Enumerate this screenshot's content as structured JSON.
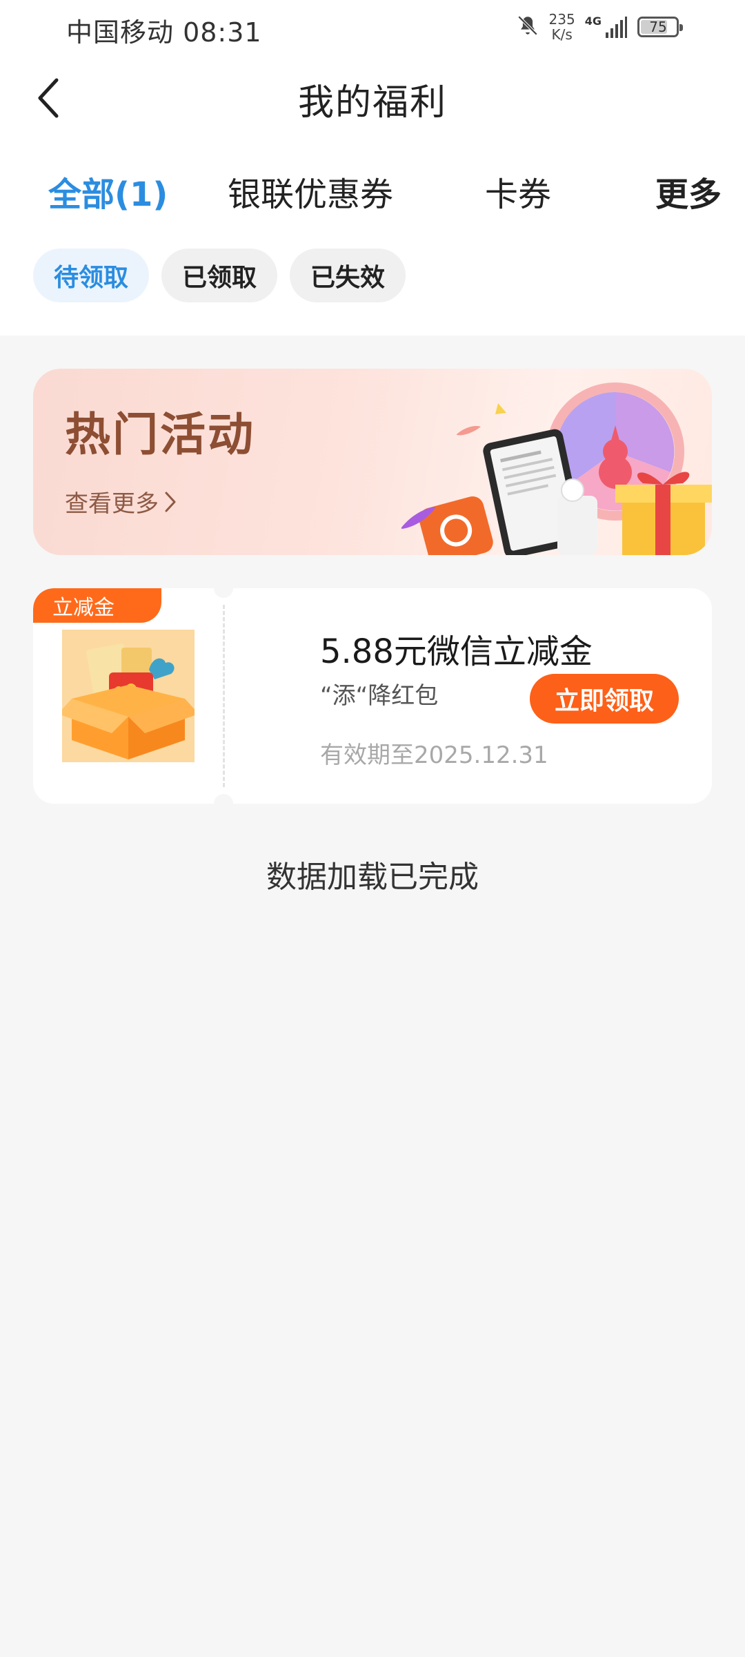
{
  "status_bar": {
    "carrier_time": "中国移动 08:31",
    "net_speed_value": "235",
    "net_speed_unit": "K/s",
    "network_type": "4G",
    "battery": "75"
  },
  "header": {
    "title": "我的福利"
  },
  "tabs": [
    {
      "label": "全部(1)",
      "active": true
    },
    {
      "label": "银联优惠券",
      "active": false
    },
    {
      "label": "卡券",
      "active": false
    },
    {
      "label": "更多",
      "active": false
    }
  ],
  "filters": [
    {
      "label": "待领取",
      "active": true
    },
    {
      "label": "已领取",
      "active": false
    },
    {
      "label": "已失效",
      "active": false
    }
  ],
  "banner": {
    "title": "热门活动",
    "more": "查看更多"
  },
  "coupon": {
    "badge": "立减金",
    "title": "5.88元微信立减金",
    "subtitle": "“添“降红包",
    "expiry": "有效期至2025.12.31",
    "button": "立即领取"
  },
  "footer": {
    "load_status": "数据加载已完成"
  },
  "colors": {
    "accent_blue": "#2b8de0",
    "accent_orange": "#fd6018",
    "banner_text": "#8d4e33"
  }
}
